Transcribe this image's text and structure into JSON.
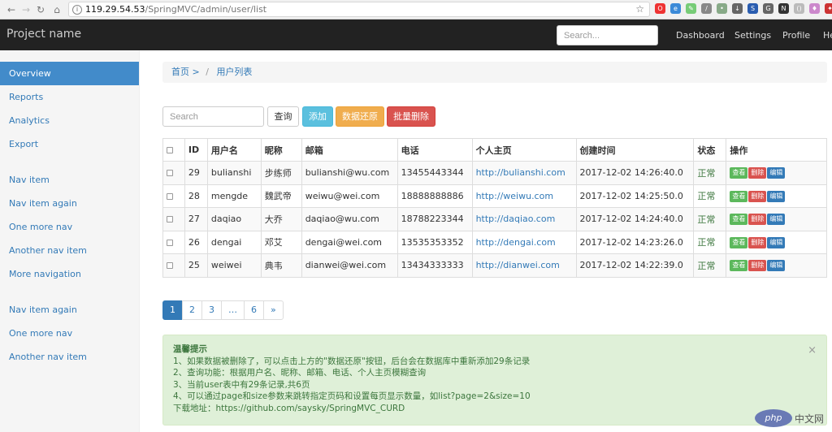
{
  "browser": {
    "url_host": "119.29.54.53",
    "url_path": "/SpringMVC/admin/user/list"
  },
  "navbar": {
    "brand": "Project name",
    "search_placeholder": "Search...",
    "links": [
      "Dashboard",
      "Settings",
      "Profile",
      "He"
    ]
  },
  "sidebar": {
    "items": [
      {
        "label": "Overview",
        "active": true
      },
      {
        "label": "Reports"
      },
      {
        "label": "Analytics"
      },
      {
        "label": "Export"
      },
      {
        "label": "Nav item"
      },
      {
        "label": "Nav item again"
      },
      {
        "label": "One more nav"
      },
      {
        "label": "Another nav item"
      },
      {
        "label": "More navigation"
      },
      {
        "label": "Nav item again"
      },
      {
        "label": "One more nav"
      },
      {
        "label": "Another nav item"
      }
    ]
  },
  "breadcrumb": {
    "home": "首页 >",
    "separator": "/",
    "current": "用户列表"
  },
  "toolbar": {
    "search_placeholder": "Search",
    "query_label": "查询",
    "add_label": "添加",
    "restore_label": "数据还原",
    "batch_delete_label": "批量删除"
  },
  "table": {
    "headers": [
      "ID",
      "用户名",
      "昵称",
      "邮箱",
      "电话",
      "个人主页",
      "创建时间",
      "状态",
      "操作"
    ],
    "rows": [
      {
        "id": "29",
        "username": "bulianshi",
        "nickname": "步练师",
        "email": "bulianshi@wu.com",
        "phone": "13455443344",
        "homepage": "http://bulianshi.com",
        "created": "2017-12-02 14:26:40.0",
        "status": "正常"
      },
      {
        "id": "28",
        "username": "mengde",
        "nickname": "魏武帝",
        "email": "weiwu@wei.com",
        "phone": "18888888886",
        "homepage": "http://weiwu.com",
        "created": "2017-12-02 14:25:50.0",
        "status": "正常"
      },
      {
        "id": "27",
        "username": "daqiao",
        "nickname": "大乔",
        "email": "daqiao@wu.com",
        "phone": "18788223344",
        "homepage": "http://daqiao.com",
        "created": "2017-12-02 14:24:40.0",
        "status": "正常"
      },
      {
        "id": "26",
        "username": "dengai",
        "nickname": "邓艾",
        "email": "dengai@wei.com",
        "phone": "13535353352",
        "homepage": "http://dengai.com",
        "created": "2017-12-02 14:23:26.0",
        "status": "正常"
      },
      {
        "id": "25",
        "username": "weiwei",
        "nickname": "典韦",
        "email": "dianwei@wei.com",
        "phone": "13434333333",
        "homepage": "http://dianwei.com",
        "created": "2017-12-02 14:22:39.0",
        "status": "正常"
      }
    ],
    "actions": {
      "view": "查看",
      "delete": "删除",
      "edit": "编辑"
    }
  },
  "pagination": {
    "pages": [
      "1",
      "2",
      "3",
      "…",
      "6",
      "»"
    ],
    "active": "1"
  },
  "alert": {
    "title": "温馨提示",
    "lines": [
      "1、如果数据被删除了，可以点击上方的\"数据还原\"按钮，后台会在数据库中重新添加29条记录",
      "2、查询功能：根据用户名、昵称、邮箱、电话、个人主页模糊查询",
      "3、当前user表中有29条记录,共6页",
      "4、可以通过page和size参数来跳转指定页码和设置每页显示数量，如list?page=2&size=10"
    ],
    "download_label": "下载地址：",
    "download_url": "https://github.com/saysky/SpringMVC_CURD",
    "close": "×"
  },
  "watermark": {
    "logo": "php",
    "text": "中文网"
  }
}
